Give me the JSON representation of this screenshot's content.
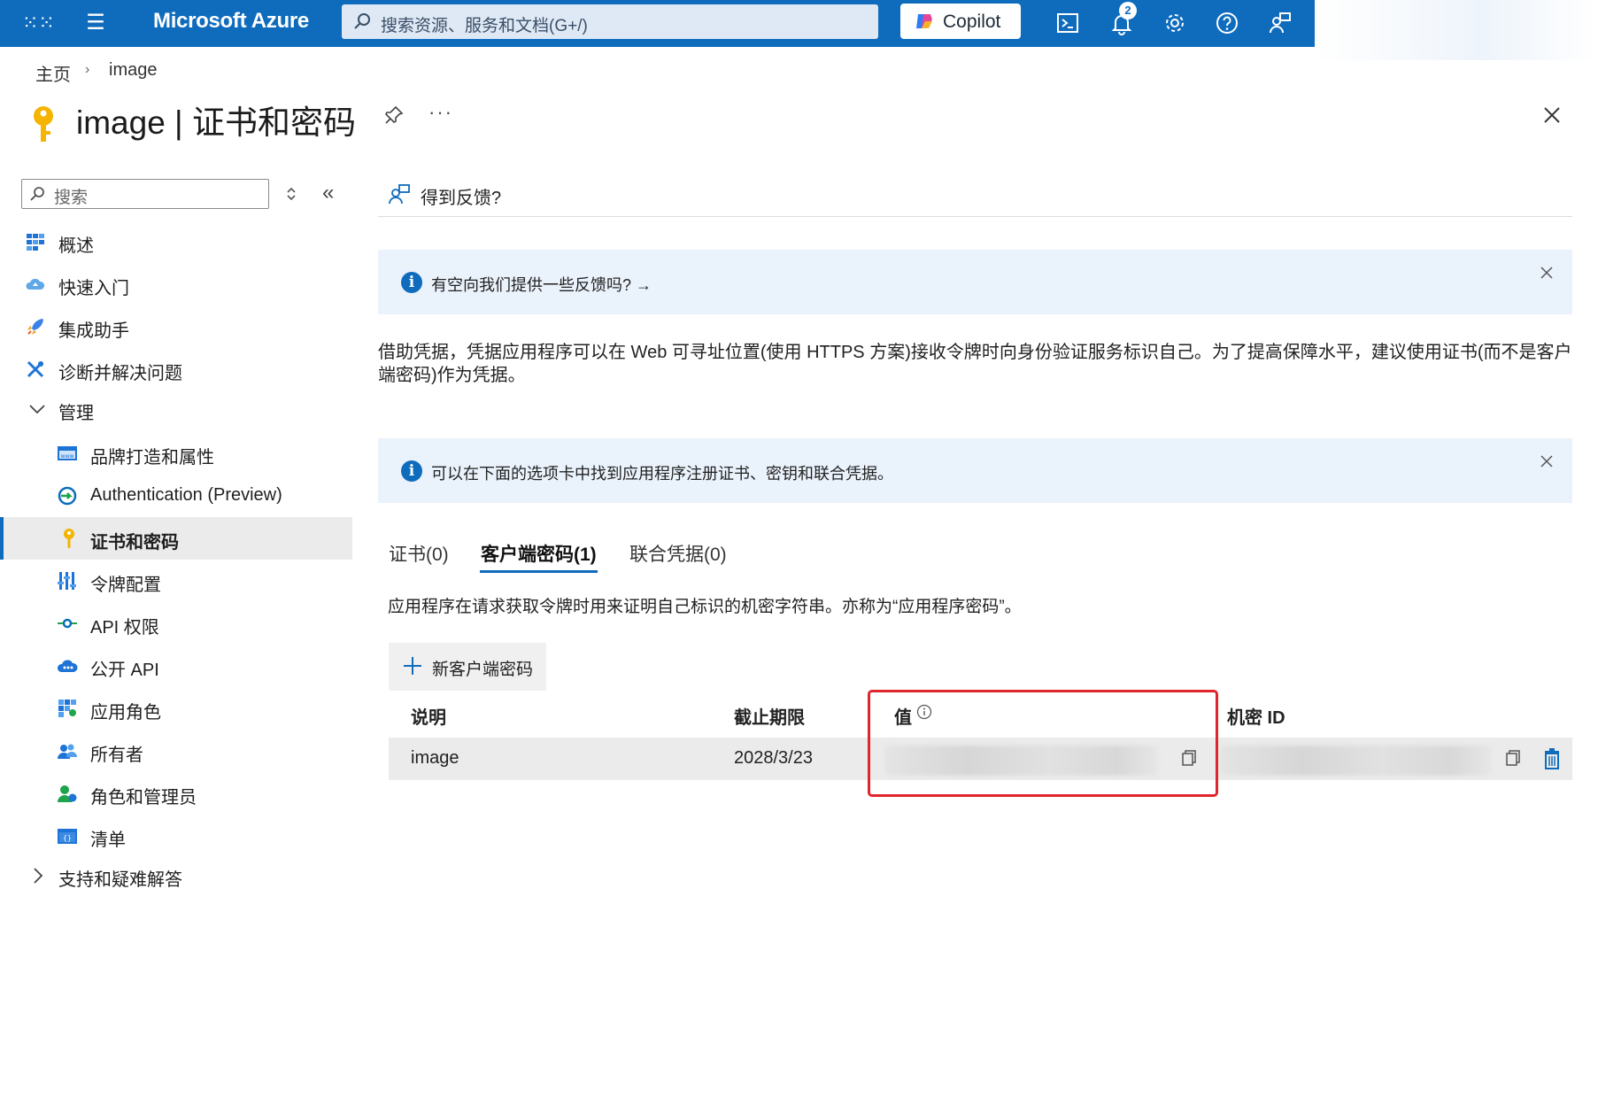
{
  "topbar": {
    "brand": "Microsoft Azure",
    "search_placeholder": "搜索资源、服务和文档(G+/)",
    "copilot_label": "Copilot",
    "notification_count": "2",
    "color": "#0f6cbd"
  },
  "breadcrumb": {
    "home": "主页",
    "current": "image"
  },
  "page": {
    "title": "image | 证书和密码",
    "more": "···"
  },
  "nav": {
    "search_placeholder": "搜索",
    "items": [
      {
        "label": "概述",
        "icon": "overview-grid-icon"
      },
      {
        "label": "快速入门",
        "icon": "cloud-quickstart-icon"
      },
      {
        "label": "集成助手",
        "icon": "rocket-icon"
      },
      {
        "label": "诊断并解决问题",
        "icon": "wrench-icon"
      },
      {
        "label": "管理",
        "icon": "chevron-down-icon"
      },
      {
        "label": "品牌打造和属性",
        "icon": "branding-icon"
      },
      {
        "label": "Authentication (Preview)",
        "icon": "authentication-icon"
      },
      {
        "label": "证书和密码",
        "icon": "key-icon",
        "selected": true
      },
      {
        "label": "令牌配置",
        "icon": "token-bars-icon"
      },
      {
        "label": "API 权限",
        "icon": "api-permission-icon"
      },
      {
        "label": "公开 API",
        "icon": "cloud-api-icon"
      },
      {
        "label": "应用角色",
        "icon": "app-roles-icon"
      },
      {
        "label": "所有者",
        "icon": "owners-icon"
      },
      {
        "label": "角色和管理员",
        "icon": "roles-admins-icon"
      },
      {
        "label": "清单",
        "icon": "manifest-icon"
      },
      {
        "label": "支持和疑难解答",
        "icon": "chevron-right-icon"
      }
    ]
  },
  "content": {
    "feedback_label": "得到反馈?",
    "banner1": "有空向我们提供一些反馈吗? →",
    "description": "借助凭据，凭据应用程序可以在 Web 可寻址位置(使用 HTTPS 方案)接收令牌时向身份验证服务标识自己。为了提高保障水平，建议使用证书(而不是客户端密码)作为凭据。",
    "banner2": "可以在下面的选项卡中找到应用程序注册证书、密钥和联合凭据。",
    "tabs": [
      "证书(0)",
      "客户端密码(1)",
      "联合凭据(0)"
    ],
    "tab_description": "应用程序在请求获取令牌时用来证明自己标识的机密字符串。亦称为“应用程序密码”。",
    "new_secret_label": "新客户端密码",
    "table": {
      "headers": [
        "说明",
        "截止期限",
        "值",
        "机密 ID"
      ],
      "rows": [
        {
          "description": "image",
          "expires": "2028/3/23"
        }
      ]
    }
  }
}
